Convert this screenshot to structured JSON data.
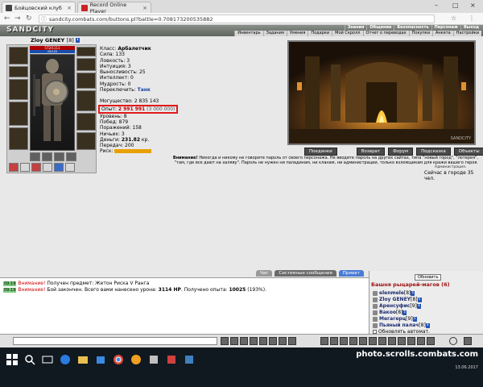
{
  "browser": {
    "tabs": [
      {
        "label": "Бойцовский клуб",
        "active": true
      },
      {
        "label": "Record Online Player",
        "active": false
      }
    ],
    "url": "sandcity.combats.com/buttons.pl?battle=0.708173200535882"
  },
  "game": {
    "logo": "SANDCITY",
    "menu_top": [
      "Знания",
      "Общение",
      "Безопасность",
      "Персонаж",
      "Выход"
    ],
    "menu_bottom": [
      "Инвентарь",
      "Задания",
      "Умения",
      "Подарки",
      "Мой Скролл",
      "Отчет о переводах",
      "Покупки",
      "Анкета",
      "Настройки"
    ]
  },
  "character": {
    "name": "Zloy GENEY",
    "level": "[8]",
    "badge": "i",
    "hp": "572/1111",
    "mp": "25/125",
    "class_label": "Класс:",
    "class": "Арбалетчик",
    "stats": [
      "Сила: 133",
      "Ловкость: 3",
      "Интуиция: 3",
      "Выносливость: 25",
      "Интеллект: 0",
      "Мудрость: 0"
    ],
    "switch_label": "Переключить:",
    "switch_value": "Танк",
    "power": "Могущество: 2 835 143",
    "exp_label": "Опыт:",
    "exp_value": "2 991 991",
    "exp_max": "(3 000 000)",
    "details": [
      "Уровень: 8",
      "Побед: 879",
      "Поражений: 158",
      "Ничьих: 3"
    ],
    "money_label": "Деньги:",
    "money_value": "231.82",
    "money_unit": "кр.",
    "transfers": "Передач: 200",
    "risk_label": "Риск:"
  },
  "location": {
    "image_label": "SANDCITY",
    "buttons": [
      "Поединки",
      "Возврат",
      "Форум",
      "Подсказка",
      "Объекты"
    ],
    "notice_bold": "Внимание!",
    "notice_text": "Никогда и никому не говорите пароль от своего персонажа. Не вводите пароль на других сайтах, типа \"новый город\", \"лотерея\", \"там, где все дают на халяву\". Пароль не нужен ни паладинам, ни кланам, ни администрации, только взломщикам для кражи вашего героя.",
    "admin": "Администрация.",
    "online": "Сейчас в городе 35 чел."
  },
  "chat": {
    "tabs": [
      "Чат",
      "Системные сообщения",
      "Приват"
    ],
    "messages": [
      {
        "time": "09:19",
        "warn": "Внимание!",
        "text": "Получен предмет: Жетон Риска V Ранга"
      },
      {
        "time": "09:19",
        "warn": "Внимание!",
        "text": "Бой закончен. Всего вами нанесено урона:",
        "bold1": "3114 HP",
        "text2": ". Получено опыта:",
        "bold2": "10025",
        "text3": "(193%)."
      }
    ]
  },
  "users": {
    "refresh": "Обновить",
    "room": "Башня рыцарей-магов (6)",
    "list": [
      {
        "name": "elenmele",
        "level": "[8]"
      },
      {
        "name": "Zloy GENEY",
        "level": "[8]"
      },
      {
        "name": "Аренсуфис",
        "level": "[9]"
      },
      {
        "name": "Вакоо",
        "level": "[8]"
      },
      {
        "name": "Мегагерц",
        "level": "[9]"
      },
      {
        "name": "Пьяный палач",
        "level": "[8]"
      }
    ],
    "auto": "Обновлять автомат."
  },
  "taskbar": {
    "watermark": "photo.scrolls.combats.com",
    "date": "13.06.2017"
  }
}
